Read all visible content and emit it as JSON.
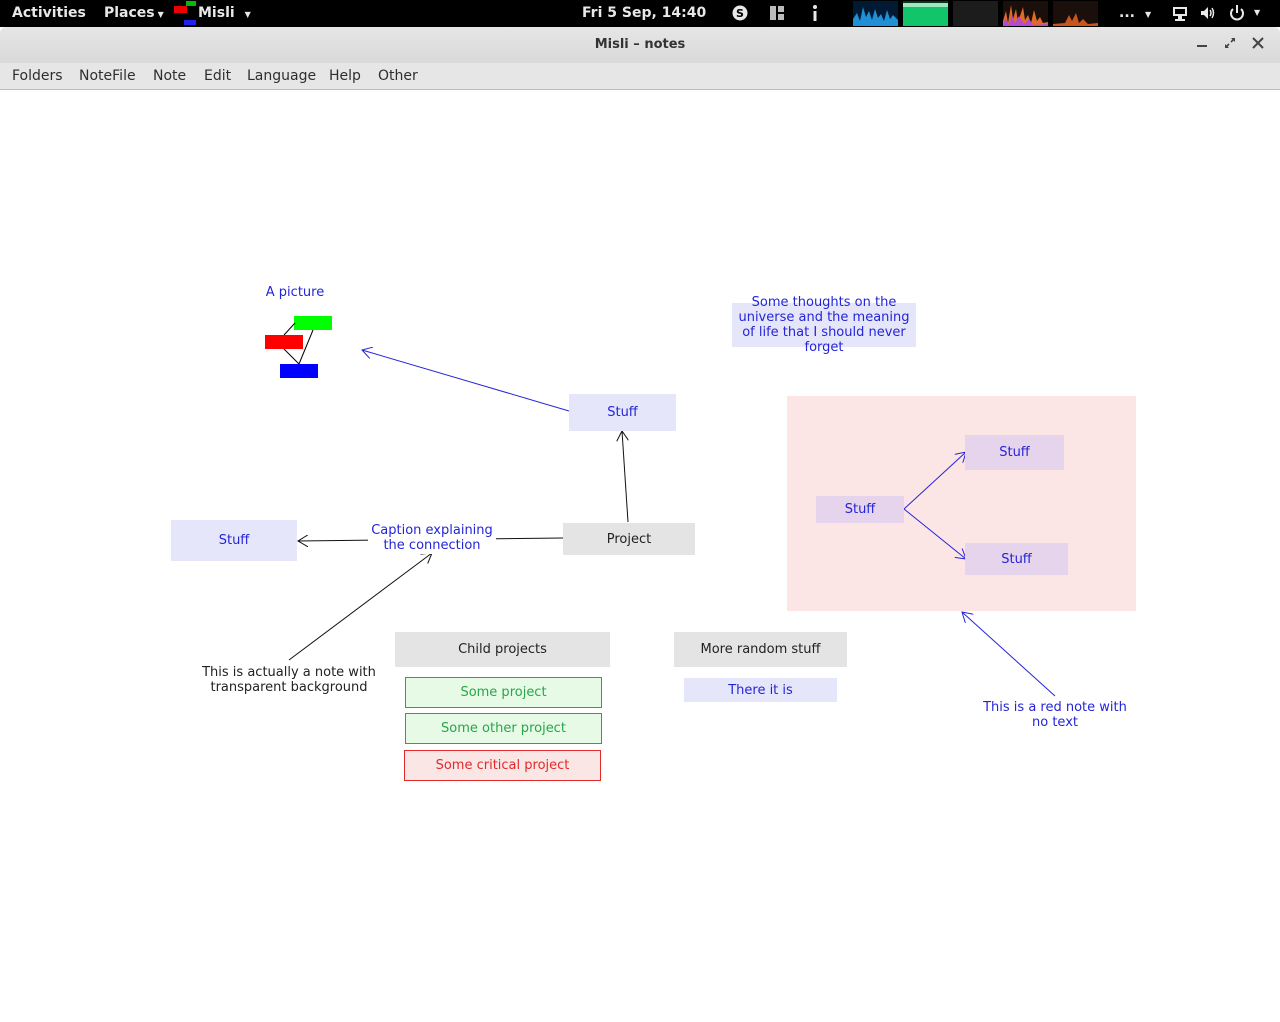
{
  "toppanel": {
    "activities": "Activities",
    "places": "Places",
    "app_name": "Misli",
    "clock": "Fri  5 Sep, 14:40",
    "more": "..."
  },
  "window": {
    "title": "Misli – notes"
  },
  "menu": [
    "Folders",
    "NoteFile",
    "Note",
    "Edit",
    "Language",
    "Help",
    "Other"
  ],
  "notes": {
    "picture_caption": "A picture",
    "thoughts": "Some thoughts on the universe and the meaning of life that I should never forget",
    "stuff_top": "Stuff",
    "stuff_left": "Stuff",
    "caption": "Caption explaining the connection",
    "project": "Project",
    "transparent_note": "This is actually a note with transparent background",
    "child_projects": "Child projects",
    "some_project": "Some project",
    "some_other_project": "Some other project",
    "some_critical_project": "Some critical project",
    "more_random": "More random stuff",
    "there_it_is": "There it is",
    "red_group_stuff": "Stuff",
    "red_group_stuff_upper": "Stuff",
    "red_group_stuff_lower": "Stuff",
    "red_note_caption": "This is a red note with no text"
  },
  "colors": {
    "note_blue_bg": "#e6e6fa",
    "note_text_blue": "#2525d8",
    "green": "#2aa54a",
    "red": "#e22a2a",
    "red_note_bg": "#fce5e5"
  },
  "icons": [
    "skype-icon",
    "workspace-icon",
    "info-icon",
    "network-icon",
    "volume-icon",
    "power-icon"
  ]
}
